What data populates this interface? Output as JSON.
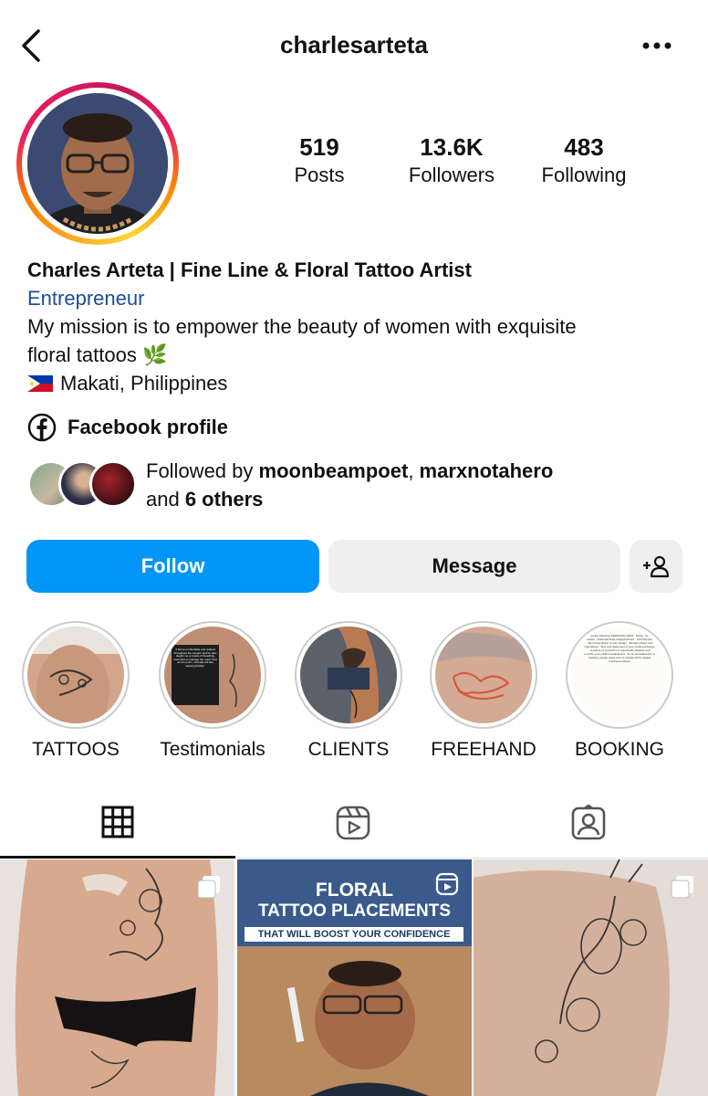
{
  "header": {
    "username": "charlesarteta",
    "back_icon": "chevron-left-icon",
    "more_icon": "more-horizontal-icon"
  },
  "stats": [
    {
      "value": "519",
      "label": "Posts"
    },
    {
      "value": "13.6K",
      "label": "Followers"
    },
    {
      "value": "483",
      "label": "Following"
    }
  ],
  "bio": {
    "name": "Charles Arteta | Fine Line & Floral Tattoo Artist",
    "category": "Entrepreneur",
    "mission_line1": "My mission is to empower the beauty of women with exquisite",
    "mission_line2": "floral tattoos 🌿",
    "location": "Makati, Philippines"
  },
  "link": {
    "label": "Facebook profile",
    "icon": "facebook-icon"
  },
  "followed_by": {
    "prefix": "Followed by ",
    "user1": "moonbeampoet",
    "sep": ", ",
    "user2": "marxnotahero",
    "and": "and ",
    "others": "6 others"
  },
  "actions": {
    "follow": "Follow",
    "message": "Message",
    "add_icon": "add-person-icon"
  },
  "highlights": [
    {
      "label": "TATTOOS"
    },
    {
      "label": "Testimonials"
    },
    {
      "label": "CLIENTS"
    },
    {
      "label": "FREEHAND"
    },
    {
      "label": "BOOKING"
    }
  ],
  "highlight_text": {
    "testimonial": "\"I felt so comfortable and relaxed throughout the session and he also taught me a couple of breathing exercises to manage the \"pain\" that at one point, I actually felt like napping [haha].\"",
    "testimonial_author": "Kristel Pineda",
    "booking": "provide the following: PERSONAL INFO · Name · Email · Location · Preferred Date of Appointment · TATTOO INFO · Short description of your design · Sample photos and inspirations · Size and placement of your preferred design · A picture of yourself at a reasonable distance and encircle your preferred placement · To be considered for a booking, please make sure to include all the details mentioned above"
  },
  "tabs": [
    {
      "icon": "grid-icon",
      "active": true
    },
    {
      "icon": "reels-icon",
      "active": false
    },
    {
      "icon": "tagged-icon",
      "active": false
    }
  ],
  "posts": {
    "reel_title_1": "FLORAL",
    "reel_title_2": "TATTOO PLACEMENTS",
    "reel_subtitle": "THAT WILL BOOST YOUR CONFIDENCE"
  },
  "colors": {
    "follow_blue": "#0095f6",
    "category_blue": "#1b4e8f",
    "button_grey": "#efefef"
  }
}
